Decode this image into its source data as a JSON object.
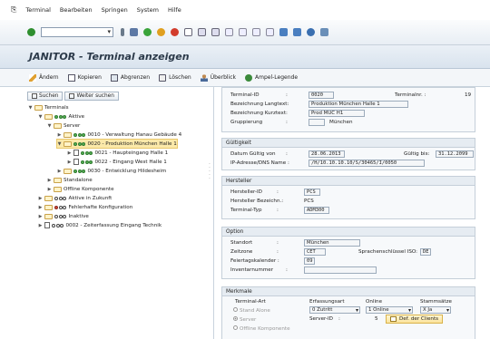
{
  "menu": {
    "items": [
      "Terminal",
      "Bearbeiten",
      "Springen",
      "System",
      "Hilfe"
    ]
  },
  "title": "JANITOR - Terminal anzeigen",
  "app_toolbar": [
    "Ändern",
    "Kopieren",
    "Abgrenzen",
    "Löschen",
    "Überblick",
    "Ampel-Legende"
  ],
  "left_tabs": [
    "Suchen",
    "Weiter suchen"
  ],
  "tree": [
    {
      "label": "Terminals"
    },
    {
      "label": "Aktive"
    },
    {
      "label": "Server"
    },
    {
      "label": "0010 - Verwaltung Hanau Gebäude 4"
    },
    {
      "label": "0020 - Produktion München Halle 1"
    },
    {
      "label": "0021 - Haupteingang Halle 1"
    },
    {
      "label": "0022 - Eingang West Halle 1"
    },
    {
      "label": "0030 - Entwicklung Hildesheim"
    },
    {
      "label": "Standalone"
    },
    {
      "label": "Offline Komponente"
    },
    {
      "label": "Aktive in Zukunft"
    },
    {
      "label": "Fehlerhafte Konfiguration"
    },
    {
      "label": "Inaktive"
    },
    {
      "label": "0002 - Zeiterfassung Eingang Technik"
    }
  ],
  "head": {
    "terminal_id_label": "Terminal-ID",
    "terminal_id": "0020",
    "terminalnr_label": "Terminalnr. :",
    "terminalnr": "19",
    "langtext_label": "Bezeichnung Langtext:",
    "langtext": "Produktion München Halle 1",
    "kurztext_label": "Bezeichnung Kurztext:",
    "kurztext": "Prod MUC H1",
    "gruppierung_label": "Gruppierung",
    "gruppierung_code": "",
    "gruppierung": "München"
  },
  "gueltigkeit": {
    "header": "Gültigkeit",
    "von_label": "Datum Gültig von",
    "von": "28.06.2013",
    "bis_label": "Gültig bis:",
    "bis": "31.12.2099",
    "ip_label": "IP-Adresse/DNS Name :",
    "ip": "/H/10.10.10.10/S/30465/I/0050"
  },
  "hersteller": {
    "header": "Hersteller",
    "id_label": "Hersteller-ID",
    "id": "PCS",
    "bez_label": "Hersteller Bezeichn.:",
    "bez": "PCS",
    "typ_label": "Terminal-Typ",
    "typ": "ADM300"
  },
  "option": {
    "header": "Option",
    "standort_label": "Standort",
    "standort": "München",
    "zeitzone_label": "Zeitzone",
    "zeitzone": "CET",
    "sprache_label": "Sprachenschlüssel ISO:",
    "sprache": "DE",
    "feiertag_label": "Feiertagskalender :",
    "feiertag": "09",
    "inventar_label": "Inventarnummer"
  },
  "merkmale": {
    "header": "Merkmale",
    "col_art": "Terminal-Art",
    "col_erfassung": "Erfassungsart",
    "col_online": "Online",
    "col_stamm": "Stammsätze",
    "opt_standalone": "Stand Alone",
    "opt_server": "Server",
    "opt_offline": "Offline Komponente",
    "erfassung_value": "0 Zutritt",
    "online_value": "1 Online",
    "stamm_value": "X Ja",
    "server_id_label": "Server-ID",
    "server_id": "",
    "def_clients": "Def. der Clients",
    "clients_count": "5"
  }
}
